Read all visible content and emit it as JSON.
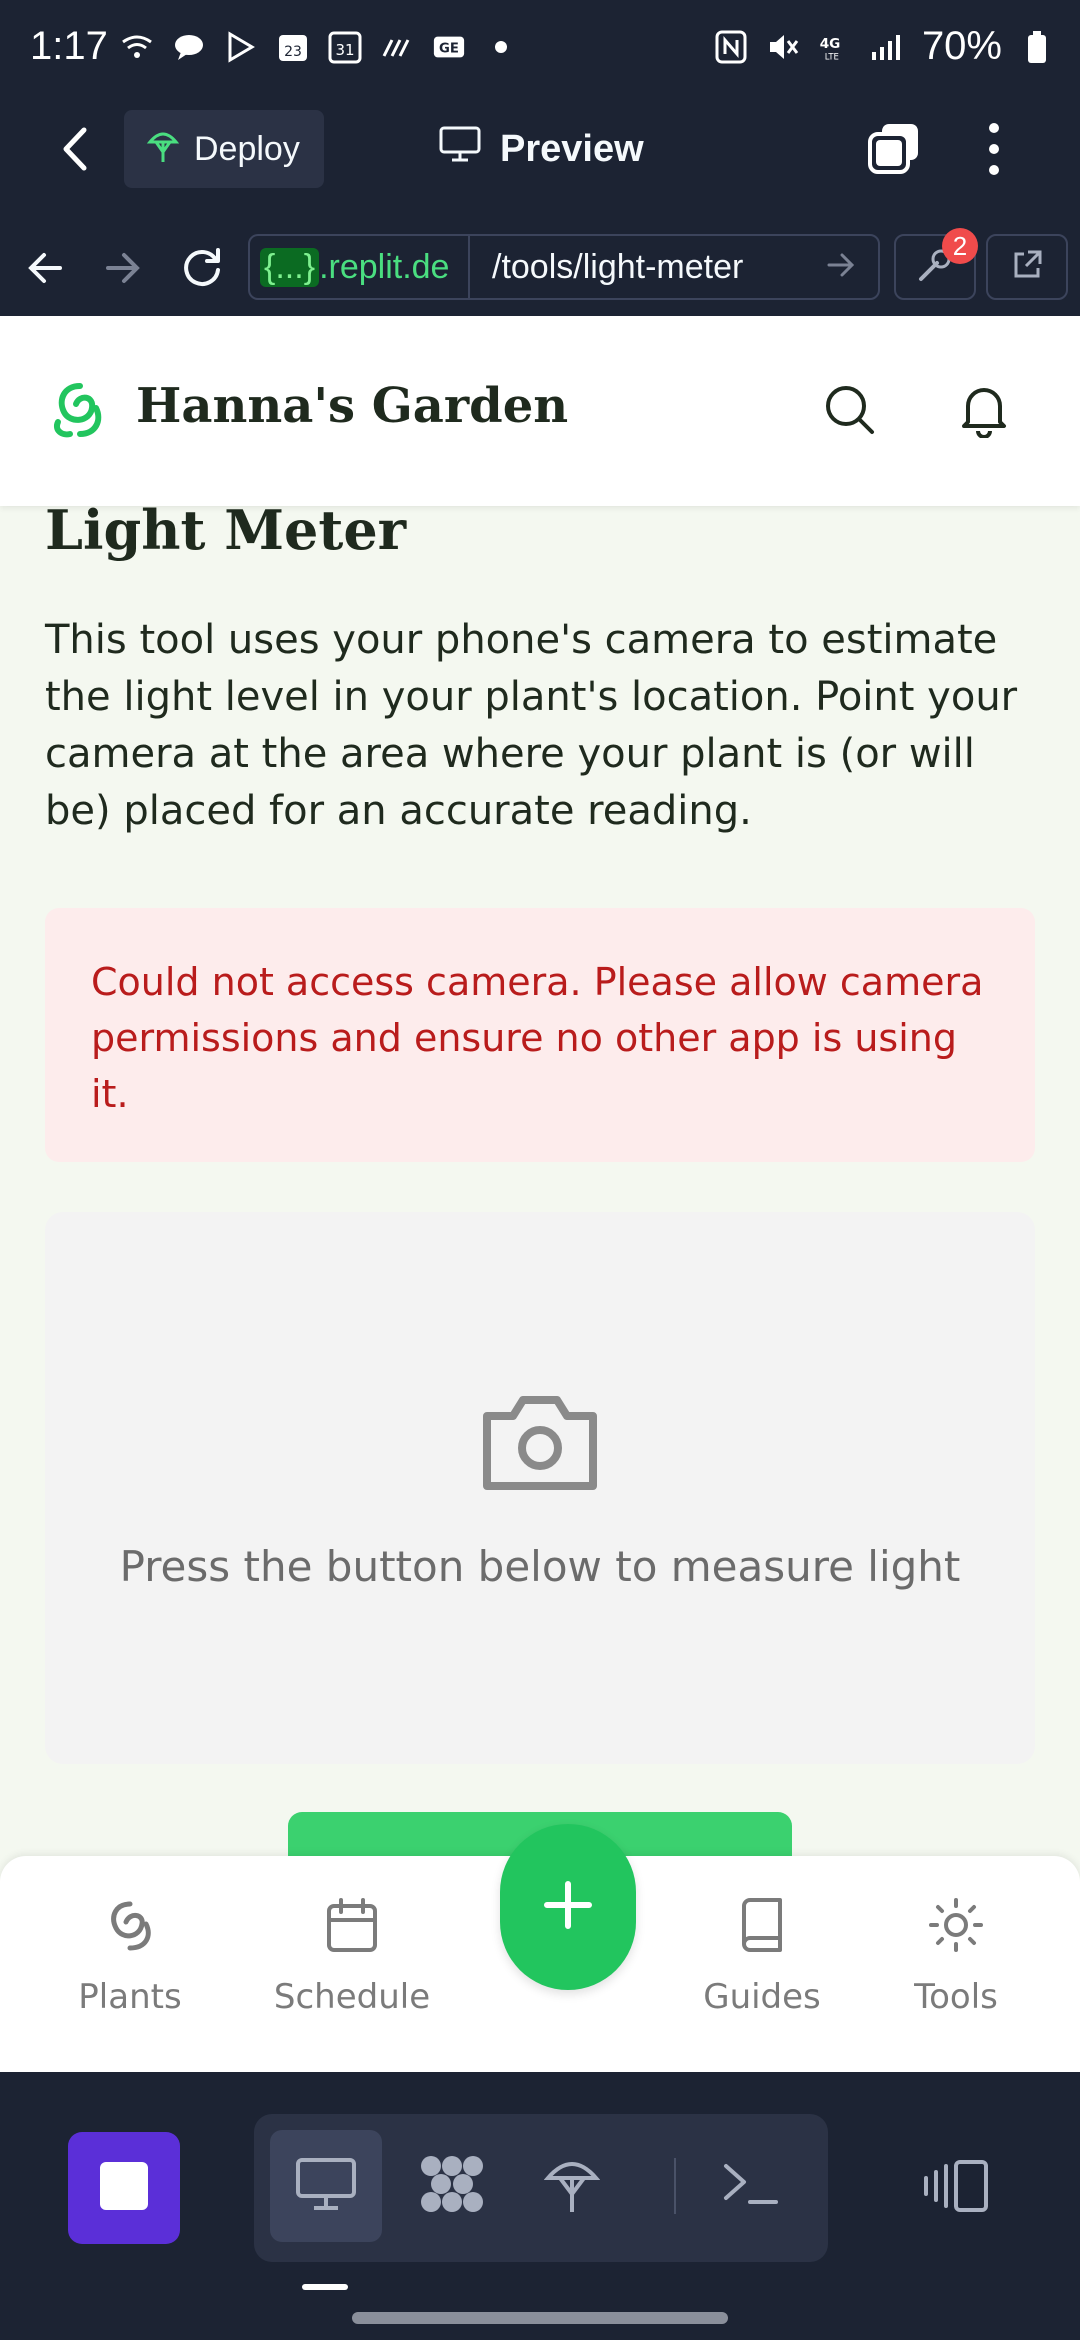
{
  "status_bar": {
    "time": "1:17",
    "battery": "70%"
  },
  "replit_toolbar": {
    "deploy_label": "Deploy",
    "preview_label": "Preview"
  },
  "url_bar": {
    "host_tag": "{...}",
    "host_suffix": ".replit.de",
    "path": "/tools/light-meter",
    "badge_count": "2"
  },
  "site": {
    "title": "Hanna's Garden",
    "page_heading": "Light Meter",
    "intro": "This tool uses your phone's camera to estimate the light level in your plant's location. Point your camera at the area where your plant is (or will be) placed for an accurate reading.",
    "error_message": "Could not access camera. Please allow camera permissions and ensure no other app is using it.",
    "camera_message": "Press the button below to measure light"
  },
  "bottom_nav": {
    "items": [
      {
        "label": "Plants",
        "icon": "plant-icon"
      },
      {
        "label": "Schedule",
        "icon": "calendar-icon"
      },
      {
        "label": "Guides",
        "icon": "book-icon"
      },
      {
        "label": "Tools",
        "icon": "sun-icon"
      }
    ],
    "fab_icon": "plus-icon"
  },
  "colors": {
    "accent_green": "#22c55e",
    "error_red": "#b91c1c",
    "replit_bg": "#1c2333",
    "dock_purple": "#5b2fd8"
  }
}
